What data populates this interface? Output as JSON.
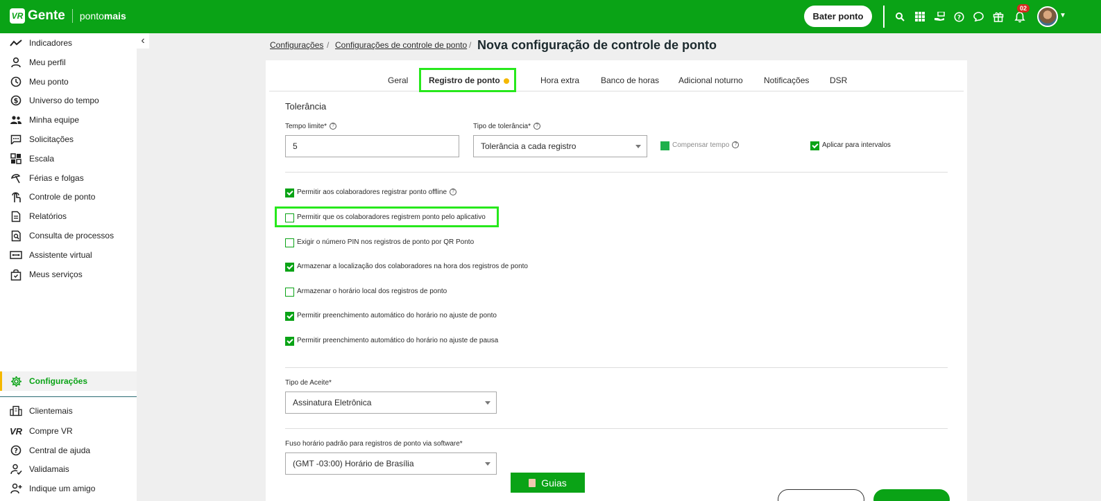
{
  "brand": {
    "logo_mark": "VR",
    "name": "Gente",
    "product_prefix": "ponto",
    "product_suffix": "mais"
  },
  "topbar": {
    "bater_ponto": "Bater ponto",
    "icons": [
      "search-icon",
      "apps-grid-icon",
      "hand-money-icon",
      "help-icon",
      "chat-icon",
      "gift-icon",
      "bell-icon"
    ],
    "notification_count": "02"
  },
  "sidebar": {
    "items": [
      {
        "label": "Indicadores",
        "icon": "chart-line-icon"
      },
      {
        "label": "Meu perfil",
        "icon": "user-icon"
      },
      {
        "label": "Meu ponto",
        "icon": "clock-icon"
      },
      {
        "label": "Universo do tempo",
        "icon": "dollar-circle-icon"
      },
      {
        "label": "Minha equipe",
        "icon": "team-icon"
      },
      {
        "label": "Solicitações",
        "icon": "message-icon"
      },
      {
        "label": "Escala",
        "icon": "grid-icon"
      },
      {
        "label": "Férias e folgas",
        "icon": "beach-icon"
      },
      {
        "label": "Controle de ponto",
        "icon": "fingerprint-icon"
      },
      {
        "label": "Relatórios",
        "icon": "report-icon"
      },
      {
        "label": "Consulta de processos",
        "icon": "search-document-icon"
      },
      {
        "label": "Assistente virtual",
        "icon": "bot-icon"
      },
      {
        "label": "Meus serviços",
        "icon": "bag-icon"
      }
    ],
    "active": {
      "label": "Configurações",
      "icon": "gear-icon"
    },
    "bottom_items": [
      {
        "label": "Clientemais",
        "icon": "building-icon"
      },
      {
        "label": "Compre VR",
        "icon": "vr-icon"
      },
      {
        "label": "Central de ajuda",
        "icon": "help-circle-icon"
      },
      {
        "label": "Validamais",
        "icon": "user-check-icon"
      },
      {
        "label": "Indique um amigo",
        "icon": "user-plus-icon"
      }
    ]
  },
  "breadcrumb": {
    "crumb1": "Configurações",
    "crumb2": "Configurações de controle de ponto",
    "separator": "/",
    "title": "Nova configuração de controle de ponto"
  },
  "tabs": [
    "Geral",
    "Registro de ponto",
    "Hora extra",
    "Banco de horas",
    "Adicional noturno",
    "Notificações",
    "DSR"
  ],
  "active_tab": "Registro de ponto",
  "tolerancia": {
    "title": "Tolerância",
    "tempo_limite_label": "Tempo limite*",
    "tempo_limite_value": "5",
    "tipo_label": "Tipo de tolerância*",
    "tipo_value": "Tolerância a cada registro",
    "compensar_label": "Compensar tempo",
    "aplicar_label": "Aplicar para intervalos"
  },
  "options": [
    {
      "label": "Permitir aos colaboradores registrar ponto offline",
      "checked": true,
      "help": true
    },
    {
      "label": "Permitir que os colaboradores registrem ponto pelo aplicativo",
      "checked": false
    },
    {
      "label": "Exigir o número PIN nos registros de ponto por QR Ponto",
      "checked": false
    },
    {
      "label": "Armazenar a localização dos colaboradores na hora dos registros de ponto",
      "checked": true
    },
    {
      "label": "Armazenar o horário local dos registros de ponto",
      "checked": false
    },
    {
      "label": "Permitir preenchimento automático do horário no ajuste de ponto",
      "checked": true
    },
    {
      "label": "Permitir preenchimento automático do horário no ajuste de pausa",
      "checked": true
    }
  ],
  "aceite": {
    "label": "Tipo de Aceite*",
    "value": "Assinatura Eletrônica"
  },
  "fuso": {
    "label": "Fuso horário padrão para registros de ponto via software*",
    "value": "(GMT -03:00) Horário de Brasília"
  },
  "guias": "Guias",
  "colors": {
    "brand_green": "#0aa316",
    "accent_yellow": "#f5b800",
    "highlight": "#27e81c"
  }
}
